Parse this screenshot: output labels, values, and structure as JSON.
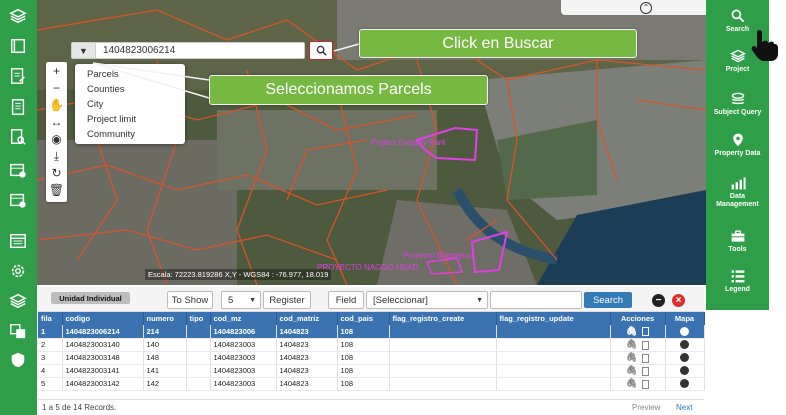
{
  "left_sidebar": {
    "icons": [
      "layers-icon",
      "book-icon",
      "edit-document-icon",
      "report-icon",
      "document-search-icon",
      "calendar-edit-icon",
      "calendar-settings-icon",
      "window-icon",
      "gear-icon",
      "layers-icon",
      "translate-icon",
      "shield-icon"
    ]
  },
  "map": {
    "search_value": "1404823006214",
    "layer_options": [
      "Parcels",
      "Counties",
      "City",
      "Project limit",
      "Community"
    ],
    "labels": {
      "gregory": "Project Gregory Park",
      "bridgeport": "Proyecto Bridgeport",
      "naggo": "PROYECTO NAGGO HEAD"
    },
    "scale_text": "Escala: 72223.819286 X,Y - WGS84 : -76.977, 18.019"
  },
  "callouts": {
    "buscar": "Click en Buscar",
    "parcels": "Seleccionamos Parcels"
  },
  "right_sidebar": {
    "items": [
      {
        "label": "Search",
        "icon": "search-icon"
      },
      {
        "label": "Project",
        "icon": "layers-icon"
      },
      {
        "label": "Subject Query",
        "icon": "stack-icon"
      },
      {
        "label": "Property Data",
        "icon": "map-pin-icon"
      },
      {
        "label": "Data Management",
        "icon": "bar-chart-icon"
      },
      {
        "label": "Tools",
        "icon": "toolbox-icon"
      },
      {
        "label": "Legend",
        "icon": "list-icon"
      }
    ]
  },
  "panel": {
    "tab": "Unidad Individual",
    "to_show_label": "To Show",
    "to_show_value": "5",
    "register_label": "Register",
    "field_label": "Field",
    "field_value": "[Seleccionar]",
    "search_label": "Search",
    "columns": [
      "fila",
      "codigo",
      "numero",
      "tipo",
      "cod_mz",
      "cod_matriz",
      "cod_pais",
      "flag_registro_create",
      "flag_registro_update",
      "Acciones",
      "Mapa"
    ],
    "rows": [
      {
        "fila": "1",
        "codigo": "1404823006214",
        "numero": "214",
        "tipo": "",
        "cod_mz": "1404823006",
        "cod_matriz": "1404823",
        "cod_pais": "108",
        "create": "",
        "update": ""
      },
      {
        "fila": "2",
        "codigo": "1404823003140",
        "numero": "140",
        "tipo": "",
        "cod_mz": "1404823003",
        "cod_matriz": "1404823",
        "cod_pais": "108",
        "create": "",
        "update": ""
      },
      {
        "fila": "3",
        "codigo": "1404823003148",
        "numero": "148",
        "tipo": "",
        "cod_mz": "1404823003",
        "cod_matriz": "1404823",
        "cod_pais": "108",
        "create": "",
        "update": ""
      },
      {
        "fila": "4",
        "codigo": "1404823003141",
        "numero": "141",
        "tipo": "",
        "cod_mz": "1404823003",
        "cod_matriz": "1404823",
        "cod_pais": "108",
        "create": "",
        "update": ""
      },
      {
        "fila": "5",
        "codigo": "1404823003142",
        "numero": "142",
        "tipo": "",
        "cod_mz": "1404823003",
        "cod_matriz": "1404823",
        "cod_pais": "108",
        "create": "",
        "update": ""
      }
    ],
    "records_text": "1 a 5 de 14 Records.",
    "preview": "Preview",
    "next": "Next"
  },
  "colors": {
    "sidebar_green": "#2e9e49",
    "callout_green": "#76b842",
    "table_blue": "#3b73b2",
    "project_magenta": "#e040e6",
    "parcel_red": "#d9532c"
  }
}
